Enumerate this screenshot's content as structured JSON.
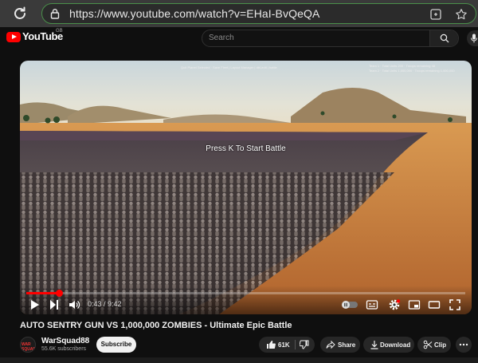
{
  "browser": {
    "url": "https://www.youtube.com/watch?v=EHaI-BvQeQA"
  },
  "header": {
    "logo_text": "YouTube",
    "logo_region": "GB",
    "search_placeholder": "Search"
  },
  "player": {
    "overlay_text": "Press K To Start Battle",
    "hud_top_center": "Quit Planet Selected · Save Fleet | Layout Manager | dbl-edit | battle",
    "hud_team1": "Team 1 · Total Units 200 · Troops remaining 48",
    "hud_team2": "Team 2 · Total Units 1,000,000 · Troops remaining 1,000,000",
    "time_current": "0:43",
    "time_separator": " / ",
    "time_total": "9:42",
    "progress_fraction": 0.074
  },
  "video": {
    "title": "AUTO SENTRY GUN VS 1,000,000 ZOMBIES - Ultimate Epic Battle"
  },
  "channel": {
    "name": "WarSquad88",
    "subscribers": "55.6K subscribers",
    "avatar_text": "WAR SQUAD",
    "subscribe_label": "Subscribe"
  },
  "actions": {
    "like_count": "61K",
    "share_label": "Share",
    "download_label": "Download",
    "clip_label": "Clip"
  },
  "colors": {
    "accent": "#ff0000",
    "url_border": "#4a8f4a",
    "page_bg": "#0f0f0f"
  }
}
